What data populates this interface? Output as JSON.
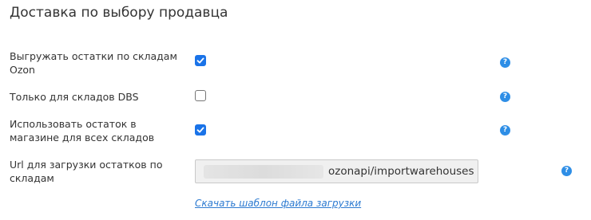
{
  "section": {
    "title": "Доставка по выбору продавца"
  },
  "rows": [
    {
      "label": "Выгружать остатки по складам Ozon",
      "checked": true,
      "help_icon": "question-icon"
    },
    {
      "label": "Только для складов DBS",
      "checked": false,
      "help_icon": "question-icon"
    },
    {
      "label": "Использовать остаток в магазине для всех складов",
      "checked": true,
      "help_icon": "question-icon"
    }
  ],
  "url_row": {
    "label": "Url для загрузки остатков по складам",
    "value_visible": "ozonapi/importwarehouses",
    "help_icon": "question-icon"
  },
  "download_link": {
    "label": "Скачать шаблон файла загрузки"
  },
  "help_glyph": "?",
  "colors": {
    "checkbox_checked": "#1a73e8",
    "help_icon": "#2e8ee6",
    "link": "#2e7bd1",
    "input_bg": "#f0f0f0"
  }
}
